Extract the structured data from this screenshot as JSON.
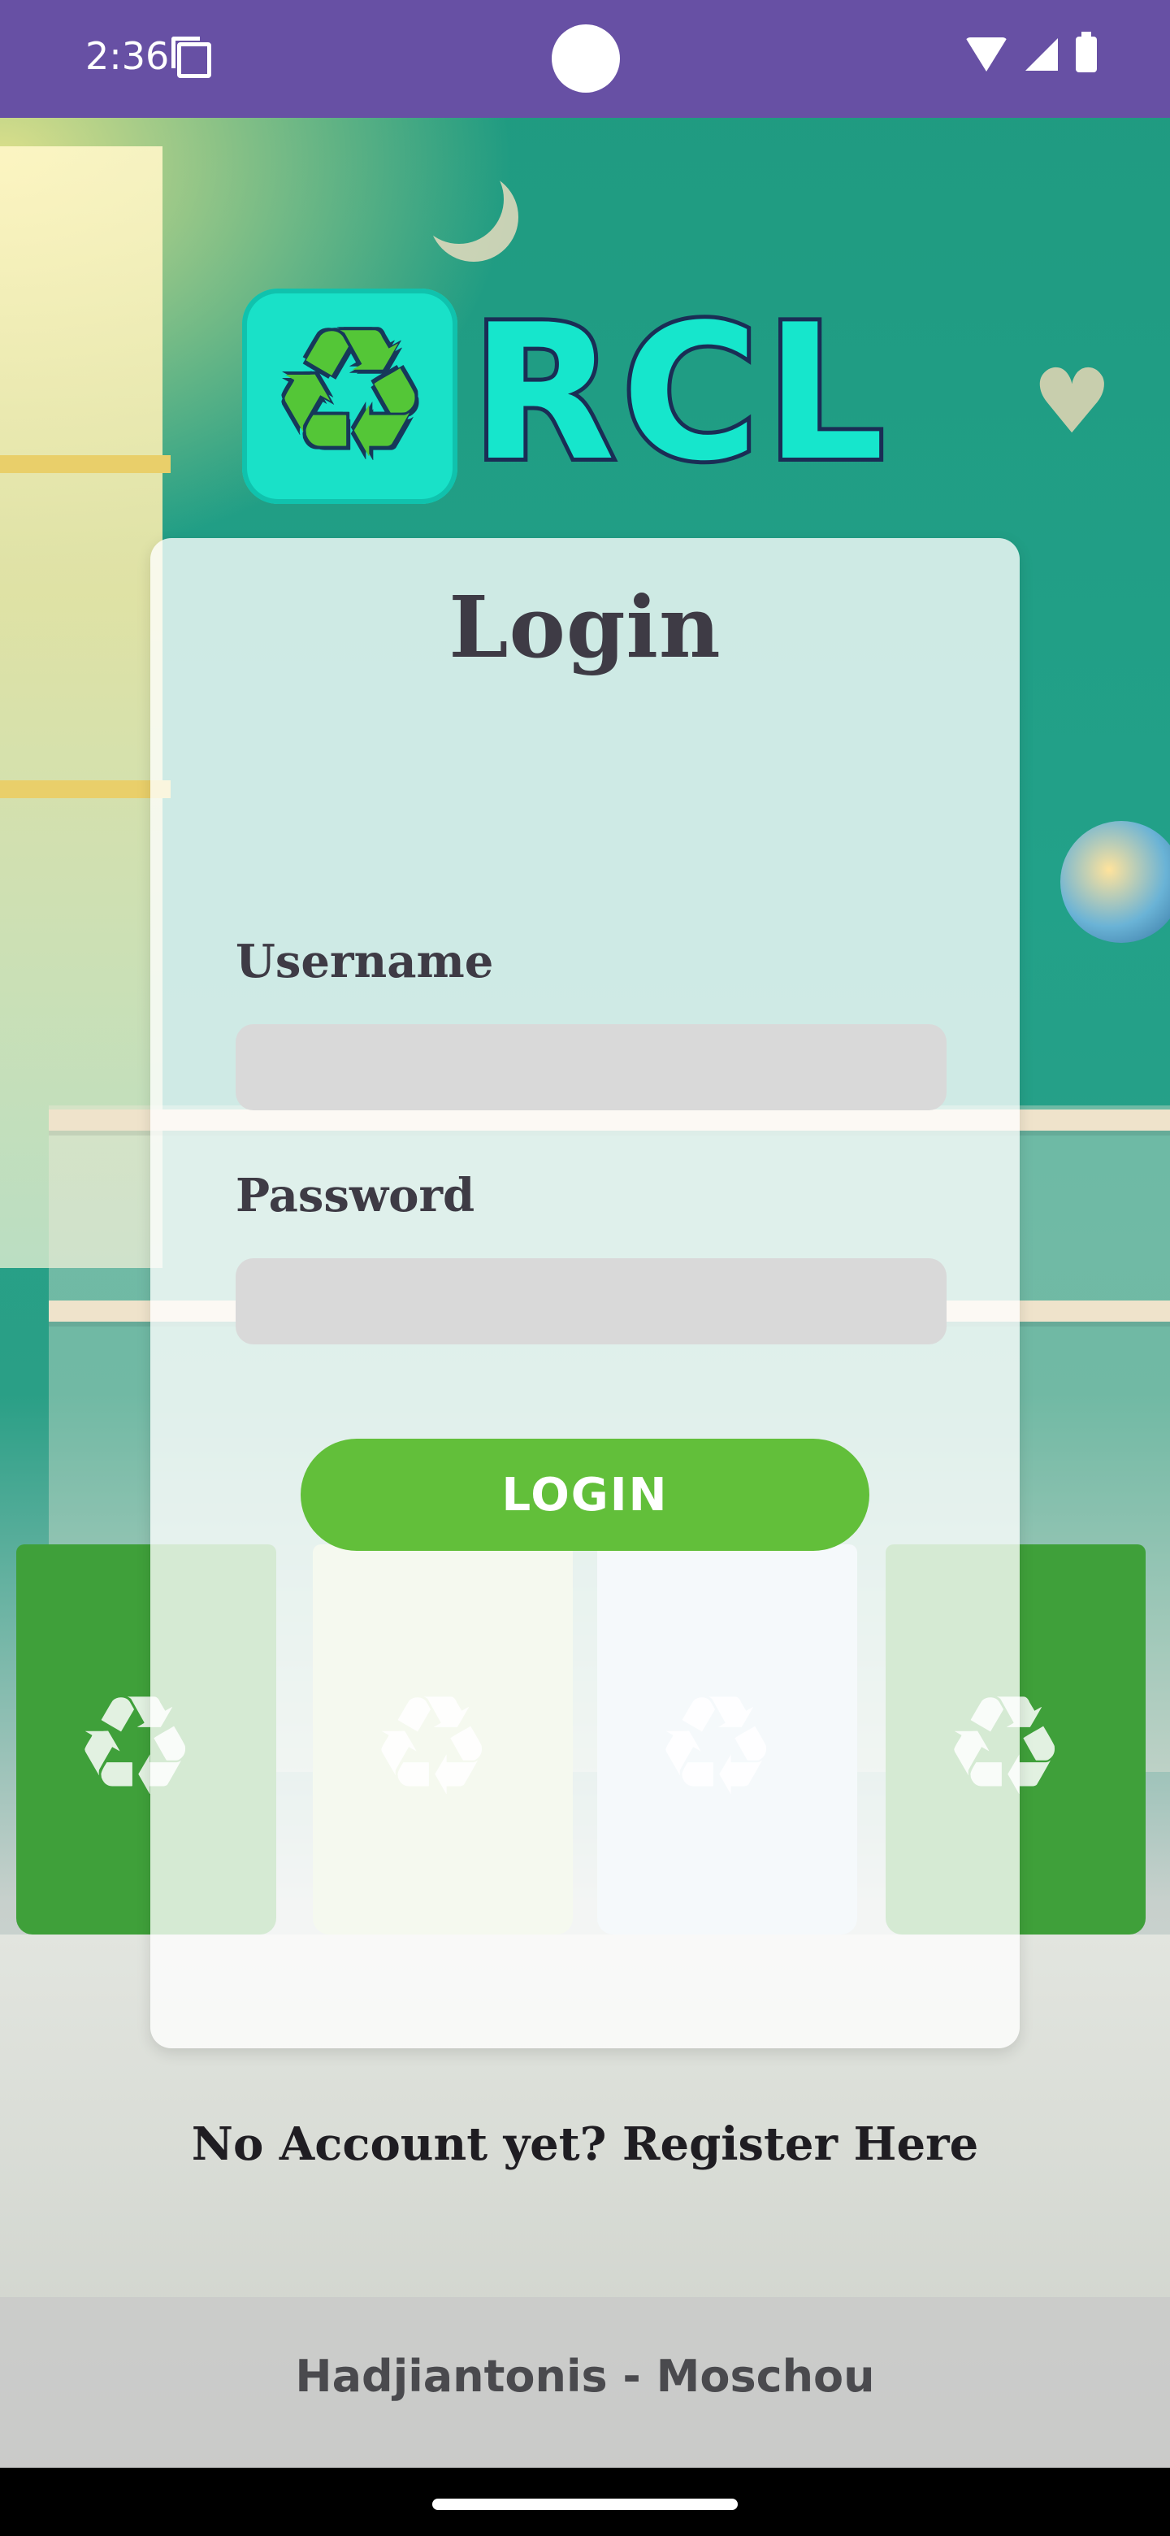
{
  "status_bar": {
    "time": "2:36",
    "icons": [
      "sim-card-icon",
      "wifi-icon",
      "signal-icon",
      "battery-icon"
    ]
  },
  "logo": {
    "text": "RCL",
    "icon": "recycle-icon",
    "colors": {
      "badge": "#19e1c8",
      "text": "#16e6cc",
      "outline": "#1a2d55",
      "leaf": "#54c637"
    }
  },
  "login_card": {
    "title": "Login",
    "username": {
      "label": "Username",
      "value": "",
      "placeholder": ""
    },
    "password": {
      "label": "Password",
      "value": "",
      "placeholder": ""
    },
    "login_button": "LOGIN"
  },
  "register_link": "No Account yet? Register Here",
  "footer": {
    "credit": "Hadjiantonis - Moschou"
  },
  "colors": {
    "status_bar": "#6750a4",
    "button": "#62bf3a",
    "input_fill": "#d9d9d9",
    "text_dark": "#3e3b45"
  }
}
